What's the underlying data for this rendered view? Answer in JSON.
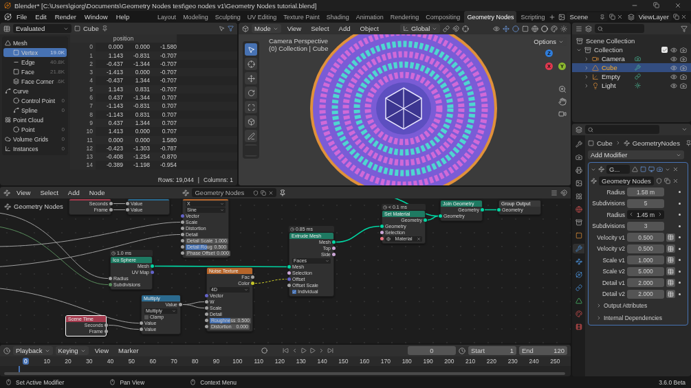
{
  "window": {
    "title": "Blender* [C:\\Users\\giorg\\Documents\\Geometry Nodes test\\geo nodes v1\\Geometry Nodes tutorial.blend]"
  },
  "menu": [
    "File",
    "Edit",
    "Render",
    "Window",
    "Help"
  ],
  "workspaces": [
    {
      "label": "Layout",
      "selected": false
    },
    {
      "label": "Modeling",
      "selected": false
    },
    {
      "label": "Sculpting",
      "selected": false
    },
    {
      "label": "UV Editing",
      "selected": false
    },
    {
      "label": "Texture Paint",
      "selected": false
    },
    {
      "label": "Shading",
      "selected": false
    },
    {
      "label": "Animation",
      "selected": false
    },
    {
      "label": "Rendering",
      "selected": false
    },
    {
      "label": "Compositing",
      "selected": false
    },
    {
      "label": "Geometry Nodes",
      "selected": true
    },
    {
      "label": "Scripting",
      "selected": false
    }
  ],
  "scene": "Scene",
  "view_layer": "ViewLayer",
  "spreadsheet": {
    "mode": "Evaluated",
    "object": "Cube",
    "domains": [
      {
        "label": "Mesh",
        "kind": "mesh",
        "selected": false,
        "children": [
          {
            "label": "Vertex",
            "count": "19.0K",
            "kind": "vertex",
            "selected": true
          },
          {
            "label": "Edge",
            "count": "40.8K",
            "kind": "edge",
            "selected": false
          },
          {
            "label": "Face",
            "count": "21.8K",
            "kind": "face",
            "selected": false
          },
          {
            "label": "Face Corner",
            "count": ".6K",
            "kind": "corner",
            "selected": false
          }
        ]
      },
      {
        "label": "Curve",
        "kind": "curve",
        "selected": false,
        "children": [
          {
            "label": "Control Point",
            "count": "0",
            "kind": "point",
            "selected": false
          },
          {
            "label": "Spline",
            "count": "0",
            "kind": "spline",
            "selected": false
          }
        ]
      },
      {
        "label": "Point Cloud",
        "kind": "cloud",
        "selected": false,
        "children": [
          {
            "label": "Point",
            "count": "0",
            "kind": "point",
            "selected": false
          }
        ]
      },
      {
        "label": "Volume Grids",
        "count": "0",
        "kind": "volume",
        "selected": false
      },
      {
        "label": "Instances",
        "count": "0",
        "kind": "instances",
        "selected": false
      }
    ],
    "column_header": "position",
    "rows": [
      {
        "index": "0",
        "values": [
          "0.000",
          "0.000",
          "-1.580"
        ]
      },
      {
        "index": "1",
        "values": [
          "1.143",
          "-0.831",
          "-0.707"
        ]
      },
      {
        "index": "2",
        "values": [
          "-0.437",
          "-1.344",
          "-0.707"
        ]
      },
      {
        "index": "3",
        "values": [
          "-1.413",
          "0.000",
          "-0.707"
        ]
      },
      {
        "index": "4",
        "values": [
          "-0.437",
          "1.344",
          "-0.707"
        ]
      },
      {
        "index": "5",
        "values": [
          "1.143",
          "0.831",
          "-0.707"
        ]
      },
      {
        "index": "6",
        "values": [
          "0.437",
          "-1.344",
          "0.707"
        ]
      },
      {
        "index": "7",
        "values": [
          "-1.143",
          "-0.831",
          "0.707"
        ]
      },
      {
        "index": "8",
        "values": [
          "-1.143",
          "0.831",
          "0.707"
        ]
      },
      {
        "index": "9",
        "values": [
          "0.437",
          "1.344",
          "0.707"
        ]
      },
      {
        "index": "10",
        "values": [
          "1.413",
          "0.000",
          "0.707"
        ]
      },
      {
        "index": "11",
        "values": [
          "0.000",
          "0.000",
          "1.580"
        ]
      },
      {
        "index": "12",
        "values": [
          "-0.423",
          "-1.303",
          "-0.787"
        ]
      },
      {
        "index": "13",
        "values": [
          "-0.408",
          "-1.254",
          "-0.870"
        ]
      },
      {
        "index": "14",
        "values": [
          "-0.389",
          "-1.198",
          "-0.954"
        ]
      }
    ],
    "rows_count": "Rows: 19,044",
    "separator": "|",
    "columns_count": "Columns: 1"
  },
  "viewport": {
    "menu": [
      "Mode",
      "View",
      "Select",
      "Add",
      "Object"
    ],
    "orientation": "Global",
    "options": "Options",
    "overlay": [
      "Camera Perspective",
      "(0) Collection | Cube"
    ],
    "gizmo_axes": [
      {
        "label": "Z",
        "color": "#2f7ddb"
      },
      {
        "label": "Y",
        "color": "#8bb82f"
      },
      {
        "label": "X",
        "color": "#e0384f"
      }
    ]
  },
  "node_editor": {
    "menu": [
      "View",
      "Select",
      "Add",
      "Node"
    ],
    "tree": "Geometry Nodes",
    "breadcrumb": "Geometry Nodes",
    "nodes": [
      {
        "color": "#a33a4d",
        "selected": false,
        "rows": [
          {
            "kind": "output",
            "label": "Seconds",
            "color": "#a1a1a1"
          },
          {
            "kind": "output",
            "label": "Frame",
            "color": "#a1a1a1"
          }
        ]
      },
      {
        "color": "#2b6a8f",
        "selected": false,
        "rows": [
          {
            "kind": "input",
            "label": "Value",
            "color": "#a1a1a1"
          },
          {
            "kind": "input",
            "label": "Value",
            "color": "#a1a1a1"
          }
        ]
      },
      {
        "title": "Ico Sphere",
        "timing": "1.0 ms",
        "color": "#1e7a62",
        "selected": false,
        "rows": [
          {
            "kind": "output",
            "label": "Mesh",
            "color": "#00d6a3"
          },
          {
            "kind": "output",
            "label": "UV Map",
            "color": "#6363c7"
          },
          {
            "kind": "input",
            "label": "Radius",
            "color": "#a1a1a1"
          },
          {
            "kind": "input",
            "label": "Subdivisions",
            "color": "#598c5c"
          }
        ]
      },
      {
        "title": "Scene Time",
        "color": "#a33a4d",
        "selected": true,
        "rows": [
          {
            "kind": "output",
            "label": "Seconds",
            "color": "#a1a1a1"
          },
          {
            "kind": "output",
            "label": "Frame",
            "color": "#a1a1a1"
          }
        ]
      },
      {
        "title": "Multiply",
        "color": "#2b6a8f",
        "selected": false,
        "rows": [
          {
            "kind": "output",
            "label": "Value",
            "color": "#a1a1a1"
          },
          {
            "kind": "dropdown",
            "label": "Multiply"
          },
          {
            "kind": "checkbox",
            "label": "Clamp",
            "checked": false
          },
          {
            "kind": "input",
            "label": "Value",
            "color": "#a1a1a1"
          },
          {
            "kind": "input",
            "label": "Value",
            "color": "#a1a1a1"
          }
        ]
      },
      {
        "color": "#b5652a",
        "selected": false,
        "rows": [
          {
            "kind": "dropdown",
            "label": "X"
          },
          {
            "kind": "dropdown",
            "label": "Sine"
          },
          {
            "kind": "input",
            "label": "Vector",
            "color": "#6363c7"
          },
          {
            "kind": "input",
            "label": "Scale",
            "color": "#a1a1a1"
          },
          {
            "kind": "input",
            "label": "Distortion",
            "color": "#a1a1a1"
          },
          {
            "kind": "input",
            "label": "Detail",
            "color": "#a1a1a1"
          },
          {
            "kind": "field",
            "label": "Detail Scale",
            "value": "1.000",
            "color": "#a1a1a1"
          },
          {
            "kind": "slider",
            "label": "Detail Roug",
            "value": "0.500",
            "level": 0.5,
            "color": "#a1a1a1"
          },
          {
            "kind": "field",
            "label": "Phase Offset",
            "value": "0.000",
            "color": "#a1a1a1"
          }
        ]
      },
      {
        "title": "Noise Texture",
        "color": "#b5652a",
        "selected": false,
        "rows": [
          {
            "kind": "output",
            "label": "Fac",
            "color": "#a1a1a1"
          },
          {
            "kind": "output",
            "label": "Color",
            "color": "#c7c729"
          },
          {
            "kind": "dropdown",
            "label": "4D"
          },
          {
            "kind": "input",
            "label": "Vector",
            "color": "#6363c7"
          },
          {
            "kind": "input",
            "label": "W",
            "color": "#a1a1a1"
          },
          {
            "kind": "input",
            "label": "Scale",
            "color": "#a1a1a1"
          },
          {
            "kind": "input",
            "label": "Detail",
            "color": "#a1a1a1"
          },
          {
            "kind": "slider",
            "label": "Roughness",
            "value": "0.500",
            "level": 0.5,
            "color": "#a1a1a1"
          },
          {
            "kind": "field",
            "label": "Distortion",
            "value": "0.000",
            "color": "#a1a1a1"
          }
        ]
      },
      {
        "title": "Extrude Mesh",
        "timing": "0.85 ms",
        "color": "#1e7a62",
        "selected": false,
        "rows": [
          {
            "kind": "output",
            "label": "Mesh",
            "color": "#00d6a3"
          },
          {
            "kind": "output",
            "label": "Top",
            "color": "#cca6d6"
          },
          {
            "kind": "output",
            "label": "Side",
            "color": "#cca6d6"
          },
          {
            "kind": "dropdown",
            "label": "Faces"
          },
          {
            "kind": "input",
            "label": "Mesh",
            "color": "#00d6a3"
          },
          {
            "kind": "input",
            "label": "Selection",
            "color": "#cca6d6"
          },
          {
            "kind": "input",
            "label": "Offset",
            "color": "#6363c7"
          },
          {
            "kind": "input",
            "label": "Offset Scale",
            "color": "#a1a1a1"
          },
          {
            "kind": "checkbox",
            "label": "Individual",
            "checked": true
          }
        ]
      },
      {
        "title": "Set Material",
        "timing": "< 0.1 ms",
        "color": "#1e7a62",
        "selected": false,
        "rows": [
          {
            "kind": "output",
            "label": "Geometry",
            "color": "#00d6a3"
          },
          {
            "kind": "input",
            "label": "Geometry",
            "color": "#00d6a3"
          },
          {
            "kind": "input",
            "label": "Selection",
            "color": "#cca6d6"
          },
          {
            "kind": "material",
            "label": "Material",
            "color": "#eb7582"
          }
        ]
      },
      {
        "title": "Join Geometry",
        "color": "#1e7a62",
        "selected": false,
        "rows": [
          {
            "kind": "output",
            "label": "Geometry",
            "color": "#00d6a3"
          },
          {
            "kind": "input",
            "label": "Geometry",
            "color": "#00d6a3"
          }
        ]
      },
      {
        "title": "Group Output",
        "color": "#3a3a3a",
        "selected": false,
        "rows": [
          {
            "kind": "input",
            "label": "Geometry",
            "color": "#00d6a3"
          }
        ]
      }
    ]
  },
  "outliner": {
    "root": "Scene Collection",
    "collection": {
      "label": "Collection",
      "checked": true
    },
    "objects": [
      {
        "label": "Camera",
        "kind": "camera",
        "selected": false
      },
      {
        "label": "Cube",
        "kind": "mesh",
        "selected": true
      },
      {
        "label": "Empty",
        "kind": "empty",
        "selected": false
      },
      {
        "label": "Light",
        "kind": "light",
        "selected": false
      }
    ]
  },
  "properties": {
    "object": "Cube",
    "modifier_path": "GeometryNodes",
    "add_modifier": "Add Modifier",
    "modifier_name": "G...",
    "node_group": "Geometry Nodes",
    "params": [
      {
        "label": "Radius",
        "value": "1.58 m",
        "kind": "plain"
      },
      {
        "label": "Subdivisions",
        "value": "5",
        "kind": "plain"
      },
      {
        "label": "Radius",
        "value": "1.45 m",
        "kind": "hover"
      },
      {
        "label": "Subdivisions",
        "value": "3",
        "kind": "plain"
      },
      {
        "label": "Velocity v1",
        "value": "0.500",
        "kind": "attribute"
      },
      {
        "label": "Velocity v2",
        "value": "0.500",
        "kind": "attribute"
      },
      {
        "label": "Scale v1",
        "value": "1.000",
        "kind": "attribute"
      },
      {
        "label": "Scale v2",
        "value": "5.000",
        "kind": "attribute"
      },
      {
        "label": "Detail v1",
        "value": "2.000",
        "kind": "attribute"
      },
      {
        "label": "Detail v2",
        "value": "2.000",
        "kind": "attribute"
      }
    ],
    "sections": [
      {
        "label": "Output Attributes",
        "expanded": false
      },
      {
        "label": "Internal Dependencies",
        "expanded": false
      }
    ]
  },
  "timeline": {
    "menu": [
      "Playback",
      "Keying",
      "View",
      "Marker"
    ],
    "frame": "0",
    "start_label": "Start",
    "start": "1",
    "end_label": "End",
    "end": "120",
    "ticks": [
      {
        "label": "0",
        "selected": true
      },
      {
        "label": "10",
        "selected": false
      },
      {
        "label": "20",
        "selected": false
      },
      {
        "label": "30",
        "selected": false
      },
      {
        "label": "40",
        "selected": false
      },
      {
        "label": "50",
        "selected": false
      },
      {
        "label": "60",
        "selected": false
      },
      {
        "label": "70",
        "selected": false
      },
      {
        "label": "80",
        "selected": false
      },
      {
        "label": "90",
        "selected": false
      },
      {
        "label": "100",
        "selected": false
      },
      {
        "label": "110",
        "selected": false
      },
      {
        "label": "120",
        "selected": false
      },
      {
        "label": "130",
        "selected": false
      },
      {
        "label": "140",
        "selected": false
      },
      {
        "label": "150",
        "selected": false
      },
      {
        "label": "160",
        "selected": false
      },
      {
        "label": "170",
        "selected": false
      },
      {
        "label": "180",
        "selected": false
      },
      {
        "label": "190",
        "selected": false
      },
      {
        "label": "200",
        "selected": false
      },
      {
        "label": "210",
        "selected": false
      },
      {
        "label": "220",
        "selected": false
      },
      {
        "label": "230",
        "selected": false
      },
      {
        "label": "240",
        "selected": false
      },
      {
        "label": "250",
        "selected": false
      }
    ]
  },
  "status_bar": {
    "items": [
      "Set Active Modifier",
      "Pan View",
      "Context Menu"
    ],
    "version": "3.6.0 Beta"
  }
}
